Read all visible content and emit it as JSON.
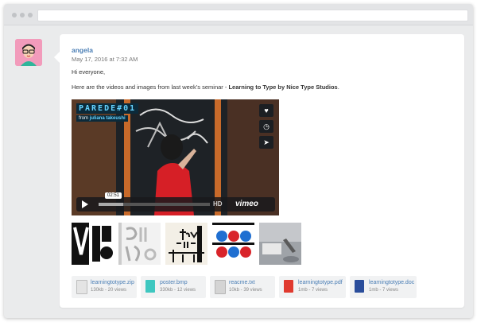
{
  "post": {
    "author": "angela",
    "date": "May 17, 2016 at 7:32 AM",
    "greeting": "Hi everyone,",
    "message_prefix": "Here are the videos and images from last week’s seminar - ",
    "message_bold": "Learning to Type by Nice Type Studios",
    "message_suffix": "."
  },
  "video": {
    "title": "PAREDE#01",
    "byline_from": "from",
    "byline_author": "juliana takeushi",
    "time": "02:51",
    "progress": 0.22,
    "hd": "HD",
    "brand": "vimeo",
    "side_icons": [
      "heart-icon",
      "clock-icon",
      "send-icon"
    ]
  },
  "thumbnails": [
    {
      "name": "thumb-1",
      "label": ""
    },
    {
      "name": "thumb-2",
      "label": ""
    },
    {
      "name": "thumb-3",
      "label": ""
    },
    {
      "name": "thumb-4",
      "label": ""
    },
    {
      "name": "thumb-5",
      "label": ""
    }
  ],
  "files": [
    {
      "name": "learningtotype.zip",
      "meta": "130kb - 20 views",
      "icon": "zip-file-icon",
      "color": "#d9d9d9"
    },
    {
      "name": "poster.bmp",
      "meta": "330kb - 12 views",
      "icon": "image-file-icon",
      "color": "#3ec7c0"
    },
    {
      "name": "reacme.txt",
      "meta": "10kb - 39 views",
      "icon": "text-file-icon",
      "color": "#c8c8c8"
    },
    {
      "name": "learningtotype.pdf",
      "meta": "1mb - 7 views",
      "icon": "pdf-file-icon",
      "color": "#e03a2f"
    },
    {
      "name": "learningtotype.doc",
      "meta": "1mb - 7 views",
      "icon": "doc-file-icon",
      "color": "#2a4d9b"
    }
  ]
}
